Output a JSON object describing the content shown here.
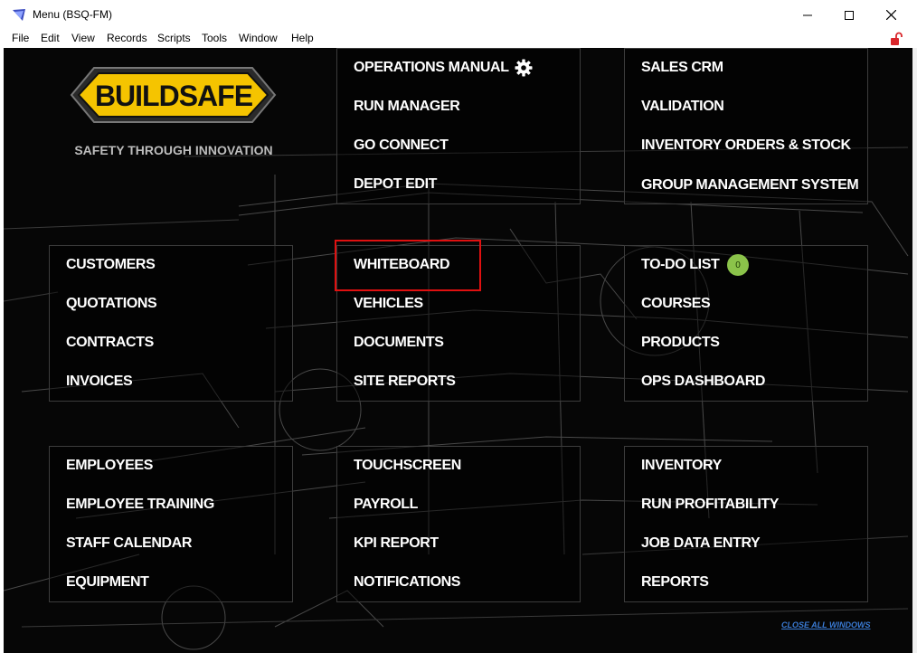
{
  "window": {
    "title": "Menu (BSQ-FM)",
    "icon": "filemaker-app-icon"
  },
  "menubar": [
    "File",
    "Edit",
    "View",
    "Records",
    "Scripts",
    "Tools",
    "Window",
    "Help"
  ],
  "logo": {
    "brand": "BUILDSAFE",
    "tagline": "SAFETY THROUGH INNOVATION"
  },
  "panels": {
    "top_center": [
      "OPERATIONS MANUAL",
      "RUN MANAGER",
      "GO CONNECT",
      "DEPOT EDIT"
    ],
    "top_right": [
      "SALES CRM",
      "VALIDATION",
      "INVENTORY ORDERS & STOCK",
      "GROUP MANAGEMENT SYSTEM"
    ],
    "mid_left": [
      "CUSTOMERS",
      "QUOTATIONS",
      "CONTRACTS",
      "INVOICES"
    ],
    "mid_center": [
      "WHITEBOARD",
      "VEHICLES",
      "DOCUMENTS",
      "SITE REPORTS"
    ],
    "mid_right": [
      "TO-DO LIST",
      "COURSES",
      "PRODUCTS",
      "OPS DASHBOARD"
    ],
    "bot_left": [
      "EMPLOYEES",
      "EMPLOYEE TRAINING",
      "STAFF CALENDAR",
      "EQUIPMENT"
    ],
    "bot_center": [
      "TOUCHSCREEN",
      "PAYROLL",
      "KPI REPORT",
      "NOTIFICATIONS"
    ],
    "bot_right": [
      "INVENTORY",
      "RUN PROFITABILITY",
      "JOB DATA ENTRY",
      "REPORTS"
    ]
  },
  "todo_count": "0",
  "close_all": "CLOSE ALL WINDOWS",
  "colors": {
    "background": "#060606",
    "text": "#ffffff",
    "highlight": "#e01010",
    "badge": "#8bc34a",
    "link": "#3a7bd5",
    "logo_yellow": "#f5c400"
  }
}
